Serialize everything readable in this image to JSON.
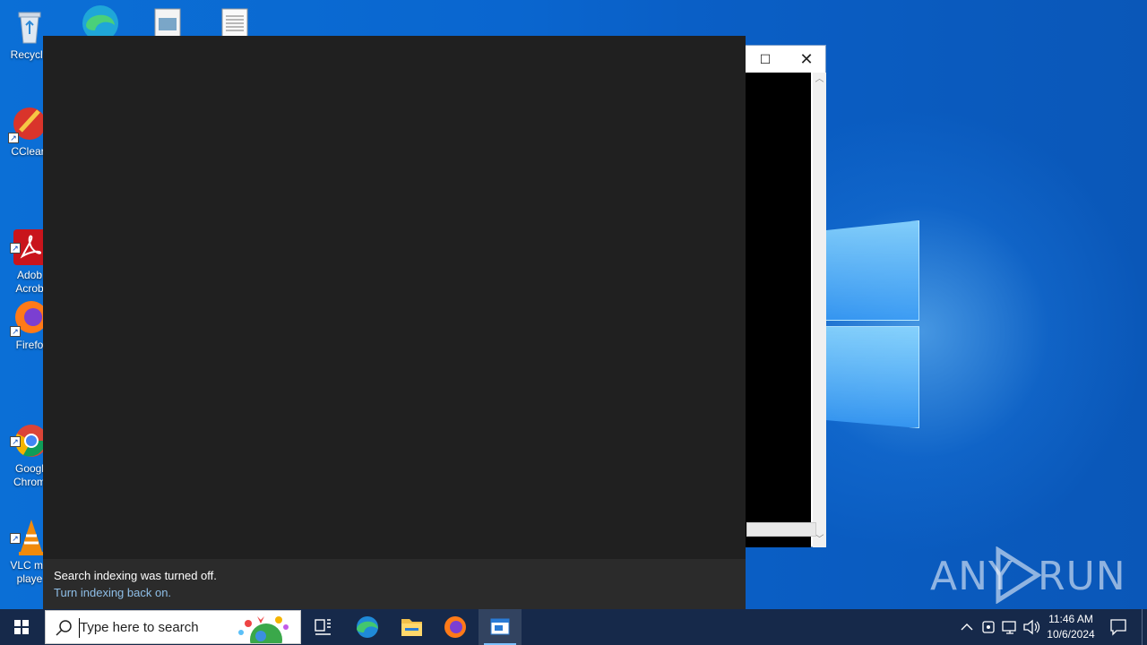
{
  "desktop": {
    "icons": [
      {
        "label": "Recycle"
      },
      {
        "label": "CClear"
      },
      {
        "label": "Adob\nAcrob"
      },
      {
        "label": "Firefo"
      },
      {
        "label": "Googl\nChrom"
      },
      {
        "label": "VLC me\nplaye"
      }
    ]
  },
  "search_panel": {
    "footer_message": "Search indexing was turned off.",
    "footer_link": "Turn indexing back on."
  },
  "taskbar": {
    "search_placeholder": "Type here to search",
    "clock_time": "11:46 AM",
    "clock_date": "10/6/2024"
  },
  "watermark": {
    "left": "ANY",
    "right": "RUN"
  }
}
